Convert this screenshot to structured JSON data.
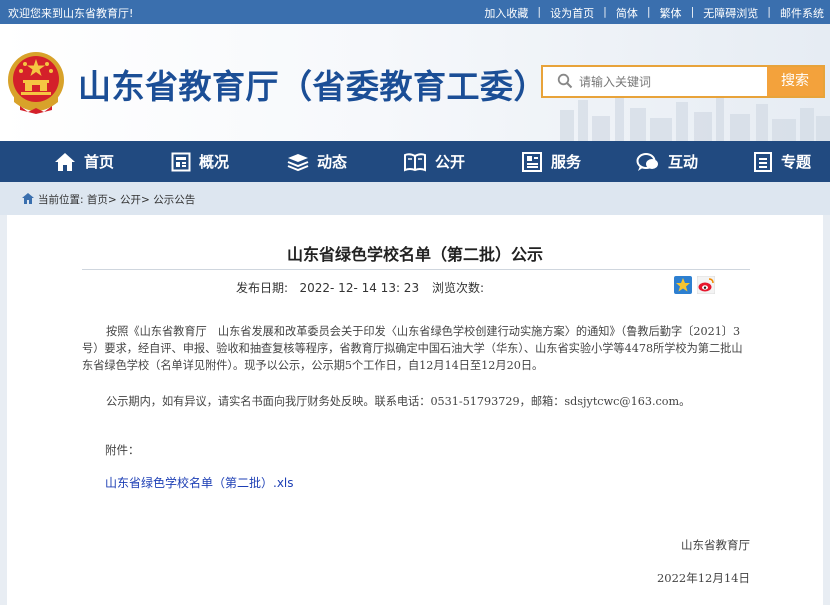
{
  "topbar": {
    "welcome": "欢迎您来到山东省教育厅!",
    "links": [
      "加入收藏",
      "设为首页",
      "简体",
      "繁体",
      "无障碍浏览",
      "邮件系统"
    ],
    "separator": "|"
  },
  "header": {
    "site_title": "山东省教育厅（省委教育工委）",
    "search_placeholder": "请输入关键词",
    "search_button": "搜索"
  },
  "nav": [
    {
      "label": "首页",
      "icon": "home-icon"
    },
    {
      "label": "概况",
      "icon": "overview-icon"
    },
    {
      "label": "动态",
      "icon": "news-icon"
    },
    {
      "label": "公开",
      "icon": "book-icon"
    },
    {
      "label": "服务",
      "icon": "service-icon"
    },
    {
      "label": "互动",
      "icon": "chat-icon"
    },
    {
      "label": "专题",
      "icon": "topic-icon"
    }
  ],
  "breadcrumb": {
    "prefix": "当前位置:",
    "items": [
      "首页",
      "公开",
      "公示公告"
    ],
    "sep": ">"
  },
  "article": {
    "title": "山东省绿色学校名单（第二批）公示",
    "date_label": "发布日期:",
    "date_value": "2022- 12- 14 13: 23",
    "views_label": "浏览次数:",
    "para1": "按照《山东省教育厅　山东省发展和改革委员会关于印发〈山东省绿色学校创建行动实施方案〉的通知》（鲁教后勤字〔2021〕3号）要求，经自评、申报、验收和抽查复核等程序，省教育厅拟确定中国石油大学（华东）、山东省实验小学等4478所学校为第二批山东省绿色学校（名单详见附件）。现予以公示，公示期5个工作日，自12月14日至12月20日。",
    "para2": "公示期内，如有异议，请实名书面向我厅财务处反映。联系电话：0531-51793729，邮箱：sdsjytcwc@163.com。",
    "attachment_label": "附件：",
    "attachment_link": "山东省绿色学校名单（第二批）.xls",
    "signature": "山东省教育厅",
    "sign_date": "2022年12月14日"
  },
  "colors": {
    "topbar": "#3a6fae",
    "nav": "#214a80",
    "title_blue": "#1b4e96",
    "search_orange": "#f3a23c",
    "link_blue": "#1d3fb5"
  }
}
